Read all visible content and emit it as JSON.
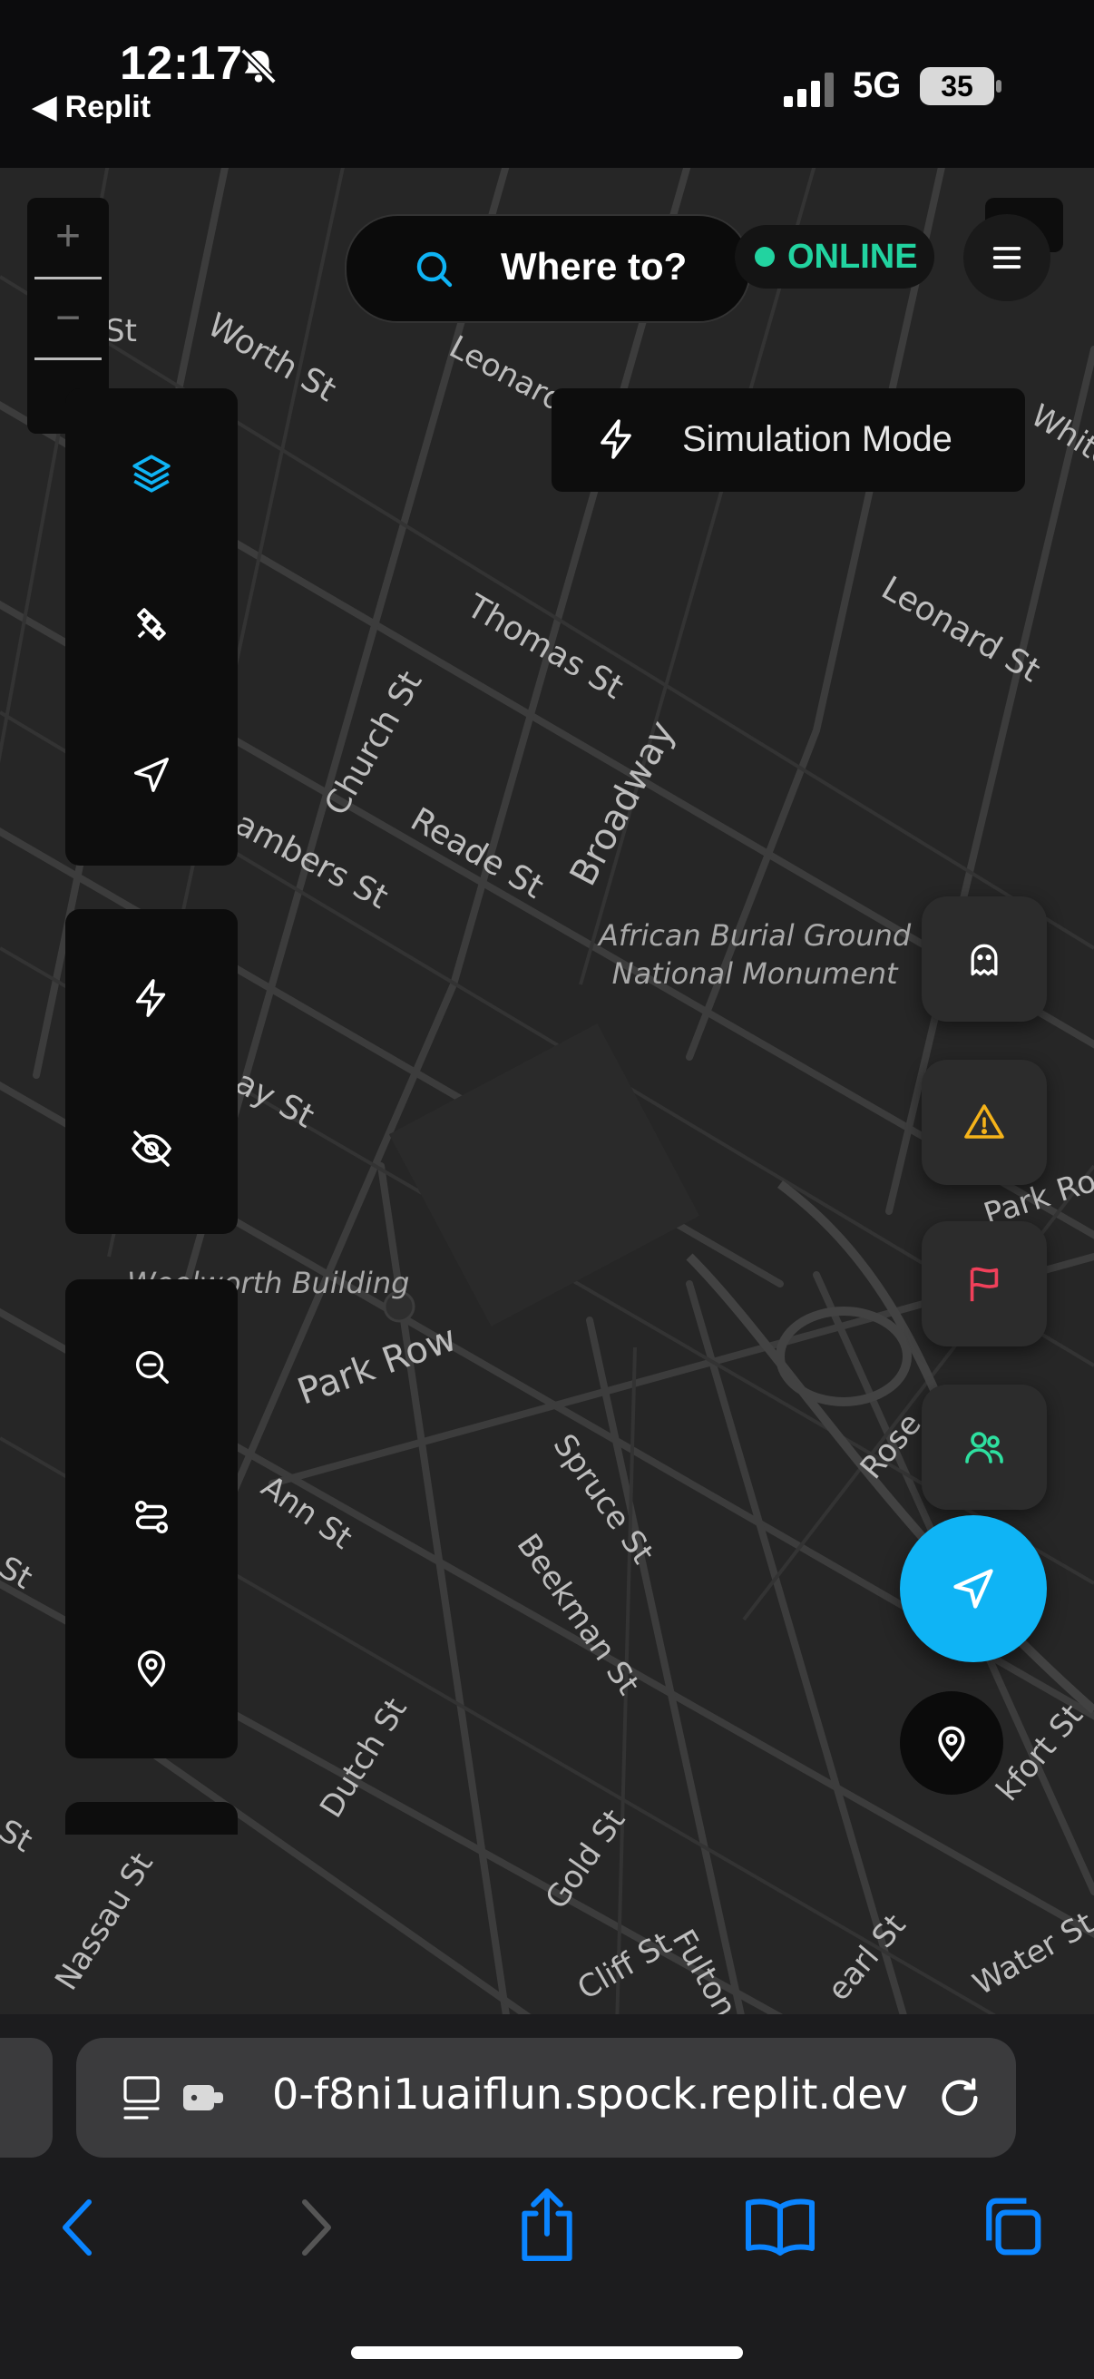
{
  "status_bar": {
    "time": "12:17",
    "back_app": "◀ Replit",
    "network": "5G",
    "battery": "35"
  },
  "search": {
    "placeholder_text": "Where to?"
  },
  "connection": {
    "status": "ONLINE",
    "color": "#22d3a0"
  },
  "simulation": {
    "label": "Simulation Mode"
  },
  "map": {
    "streets": {
      "worth": "Worth St",
      "leonard_top": "Leonard St",
      "leonard_right": "Leonard St",
      "thomas": "Thomas St",
      "church": "Church St",
      "reade": "Reade St",
      "broadway": "Broadway",
      "chambers": "ambers St",
      "murray": "ay St",
      "park_row": "Park Row",
      "spruce": "Spruce St",
      "ann": "Ann St",
      "beekman": "Beekman St",
      "dutch": "Dutch St",
      "gold": "Gold St",
      "nassau": "Nassau St",
      "cliff": "Cliff St",
      "fulton": "Fulton S",
      "pearl": "earl St",
      "water": "Water St",
      "park_row_right": "Park Ro",
      "rose": "Rose",
      "frankfort": "kfort St",
      "white": "White",
      "st_left1": "St",
      "st_left2": "St",
      "st_left3": "St"
    },
    "pois": {
      "african_burial_1": "African Burial Ground",
      "african_burial_2": "National Monument",
      "woolworth": "Woolworth Building"
    }
  },
  "zoom": {
    "plus": "+",
    "minus": "−"
  },
  "left_toolbar": [
    {
      "icon": "layers-icon"
    },
    {
      "icon": "satellite-icon"
    },
    {
      "icon": "navigation-arrow-icon"
    },
    {
      "icon": "lightning-icon"
    },
    {
      "icon": "eye-off-icon"
    },
    {
      "icon": "zoom-out-icon"
    },
    {
      "icon": "route-icon"
    },
    {
      "icon": "map-pin-icon"
    }
  ],
  "right_actions": [
    {
      "icon": "ghost-icon",
      "color": "#ffffff"
    },
    {
      "icon": "warning-icon",
      "color": "#f5b31a"
    },
    {
      "icon": "flag-icon",
      "color": "#f0405a"
    },
    {
      "icon": "users-icon",
      "color": "#2ee0a0"
    }
  ],
  "accent_color": "#0fb4f5",
  "browser": {
    "url": "0-f8ni1uaiflun.spock.replit.dev"
  }
}
